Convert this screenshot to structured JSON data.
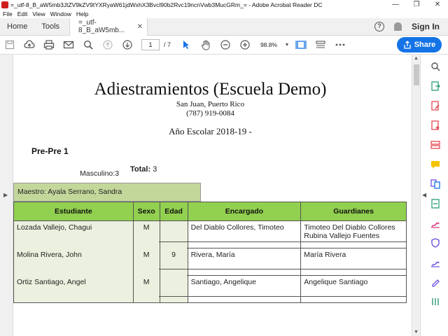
{
  "window": {
    "title": "=_utf-8_B_aW5mb3JtZV9kZV9tYXRyaW61jdWxhX3Bvcl90b2Rvc19ncnVwb3MucGRm_= - Adobe Acrobat Reader DC",
    "minimize": "—",
    "maximize": "❐",
    "close": "✕"
  },
  "menu": [
    "File",
    "Edit",
    "View",
    "Window",
    "Help"
  ],
  "tabs": {
    "home": "Home",
    "tools": "Tools",
    "document": "=_utf-8_B_aW5mb...",
    "close": "✕",
    "help": "?",
    "signin": "Sign In"
  },
  "toolbar": {
    "page_current": "1",
    "page_total": "/ 7",
    "zoom": "98.8%",
    "share": "Share"
  },
  "document": {
    "title": "Adiestramientos (Escuela Demo)",
    "city": "San Juan, Puerto Rico",
    "phone": "(787) 919-0084",
    "school_year": "Año Escolar 2018-19 -",
    "group": "Pre-Pre 1",
    "total_label": "Total:",
    "total_value": "3",
    "masculino": "Masculino:3",
    "teacher": "Maestro: Ayala Serrano, Sandra",
    "columns": [
      "Estudiante",
      "Sexo",
      "Edad",
      "Encargado",
      "Guardianes"
    ],
    "rows": [
      {
        "student": "Lozada Vallejo, Chagui",
        "sex": "M",
        "age": "",
        "guardian": "Del Diablo Collores, Timoteo",
        "tutors": [
          "Timoteo  Del Diablo Collores",
          "Rubina  Vallejo Fuentes"
        ]
      },
      {
        "student": "Molina Rivera, John",
        "sex": "M",
        "age": "9",
        "guardian": "Rivera, María",
        "tutors": [
          "María  Rivera"
        ]
      },
      {
        "student": "Ortiz Santiago, Angel",
        "sex": "M",
        "age": "",
        "guardian": "Santiago, Angelique",
        "tutors": [
          "Angelique  Santiago"
        ]
      }
    ]
  },
  "colors": {
    "header_green": "#92d050",
    "teacher_green": "#c4d79b",
    "row_green": "#ebf1de",
    "accent_blue": "#1473e6"
  },
  "right_panel_icons": [
    "export-pdf-icon",
    "edit-pdf-icon",
    "create-pdf-icon",
    "organize-pages-icon",
    "comment-icon",
    "combine-files-icon",
    "scan-icon",
    "fill-sign-icon",
    "protect-icon",
    "send-for-signature-icon",
    "more-tools-icon"
  ]
}
